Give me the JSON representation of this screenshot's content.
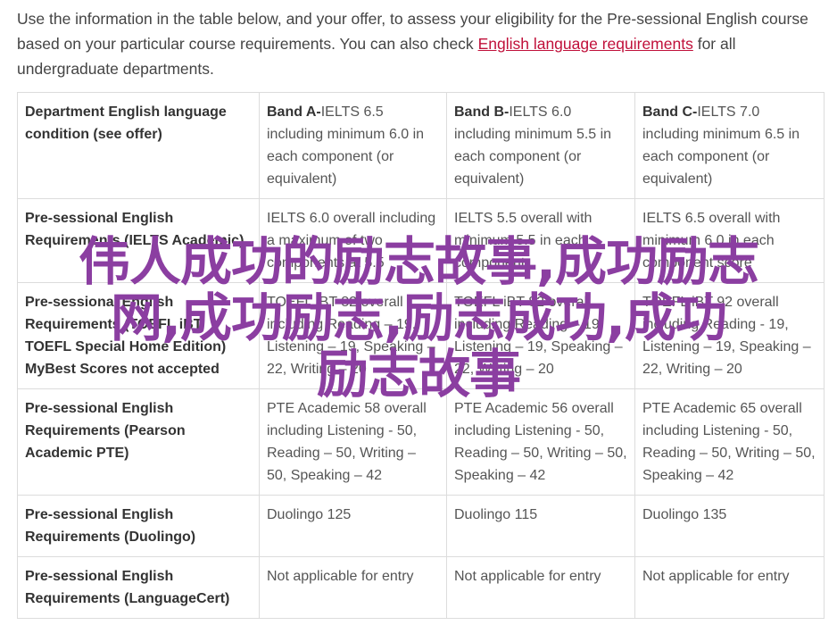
{
  "intro": {
    "text_before_link": "Use the information in the table below, and your offer, to assess your eligibility for the Pre-sessional English course based on your particular course requirements. You can also check ",
    "link_label": "English language requirements",
    "text_after_link": " for all undergraduate departments."
  },
  "table": {
    "header": {
      "label": "Department English language condition (see offer)",
      "bands": [
        {
          "name": "Band A-",
          "detail": "IELTS 6.5 including minimum 6.0 in each component (or equivalent)"
        },
        {
          "name": "Band B-",
          "detail": "IELTS 6.0 including minimum 5.5 in each component (or equivalent)"
        },
        {
          "name": "Band C-",
          "detail": "IELTS 7.0 including minimum 6.5 in each component (or equivalent)"
        }
      ]
    },
    "rows": [
      {
        "label": "Pre-sessional English Requirements (IELTS Academic)",
        "cells": [
          "IELTS 6.0 overall including a maximum of two components at 5.5",
          "IELTS 5.5 overall with minimum 5.5 in each component",
          "IELTS 6.5 overall with minimum 6.0 in each component score"
        ]
      },
      {
        "label": "Pre-sessional English Requirements (TOEFL iBT TOEFL Special Home Edition) MyBest Scores not accepted",
        "cells": [
          "TOEFL iBT 82 overall including Reading – 19, Listening – 19, Speaking – 22, Writing – 20",
          "TOEFL iBT 82 overall including Reading – 19, Listening – 19, Speaking – 22, Writing – 20",
          "TOEFL iBT 92 overall including Reading - 19, Listening – 19, Speaking – 22, Writing – 20"
        ]
      },
      {
        "label": "Pre-sessional English Requirements (Pearson Academic PTE)",
        "cells": [
          "PTE Academic 58 overall including Listening - 50, Reading – 50, Writing – 50, Speaking – 42",
          "PTE Academic 56 overall including Listening - 50, Reading – 50, Writing – 50, Speaking – 42",
          "PTE Academic 65 overall including Listening - 50, Reading – 50, Writing – 50, Speaking – 42"
        ]
      },
      {
        "label": "Pre-sessional English Requirements (Duolingo)",
        "cells": [
          "Duolingo 125",
          "Duolingo 115",
          "Duolingo 135"
        ]
      },
      {
        "label": "Pre-sessional English Requirements (LanguageCert)",
        "cells": [
          "Not applicable for entry",
          "Not applicable for entry",
          "Not applicable for entry"
        ]
      }
    ]
  },
  "watermark": {
    "lines": [
      "伟人成功的励志故事,成功励志",
      "网,成功励志,励志成功,成功",
      "励志故事"
    ],
    "color": "#8b3ea1"
  },
  "colors": {
    "link": "#c0103a",
    "border": "#dcdcdc",
    "text": "#444444"
  }
}
